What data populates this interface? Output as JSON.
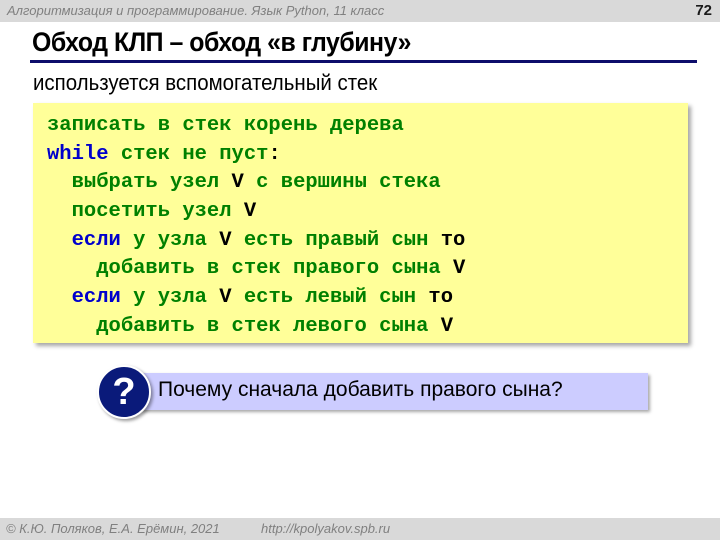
{
  "header": {
    "course": "Алгоритмизация и программирование. Язык Python, 11 класс",
    "slide_number": "72"
  },
  "title": "Обход КЛП – обход «в глубину»",
  "subtitle": "используется вспомогательный стек",
  "colors": {
    "code_background": "#ffff99",
    "code_text": "#008000",
    "keyword": "#0000cc",
    "variable": "#000000",
    "title_underline": "#0d0d6b",
    "question_background": "#ccccff",
    "question_icon": "#0a1a7a",
    "bar_background": "#d9d9d9"
  },
  "code": [
    {
      "indent": "",
      "tokens": [
        {
          "text": "записать в стек корень дерева",
          "kind": "green"
        }
      ]
    },
    {
      "indent": "",
      "tokens": [
        {
          "text": "while",
          "kind": "blue"
        },
        {
          "text": " стек не пуст",
          "kind": "green"
        },
        {
          "text": ":",
          "kind": "black"
        }
      ]
    },
    {
      "indent": "  ",
      "tokens": [
        {
          "text": "выбрать узел ",
          "kind": "green"
        },
        {
          "text": "V",
          "kind": "black"
        },
        {
          "text": " с вершины стека",
          "kind": "green"
        }
      ]
    },
    {
      "indent": "  ",
      "tokens": [
        {
          "text": "посетить узел ",
          "kind": "green"
        },
        {
          "text": "V",
          "kind": "black"
        }
      ]
    },
    {
      "indent": "  ",
      "tokens": [
        {
          "text": "если",
          "kind": "blue"
        },
        {
          "text": " у узла ",
          "kind": "green"
        },
        {
          "text": "V",
          "kind": "black"
        },
        {
          "text": " есть правый сын ",
          "kind": "green"
        },
        {
          "text": "то",
          "kind": "black"
        }
      ]
    },
    {
      "indent": "    ",
      "tokens": [
        {
          "text": "добавить в стек правого сына ",
          "kind": "green"
        },
        {
          "text": "V",
          "kind": "black"
        }
      ]
    },
    {
      "indent": "  ",
      "tokens": [
        {
          "text": "если",
          "kind": "blue"
        },
        {
          "text": " у узла ",
          "kind": "green"
        },
        {
          "text": "V",
          "kind": "black"
        },
        {
          "text": " есть левый сын ",
          "kind": "green"
        },
        {
          "text": "то",
          "kind": "black"
        }
      ]
    },
    {
      "indent": "    ",
      "tokens": [
        {
          "text": "добавить в стек левого сына ",
          "kind": "green"
        },
        {
          "text": "V",
          "kind": "black"
        }
      ]
    }
  ],
  "question": {
    "icon": "question-mark-icon",
    "icon_glyph": "?",
    "text": "Почему сначала добавить правого сына?"
  },
  "footer": {
    "copyright": "© К.Ю. Поляков, Е.А. Ерёмин, 2021",
    "url": "http://kpolyakov.spb.ru"
  }
}
